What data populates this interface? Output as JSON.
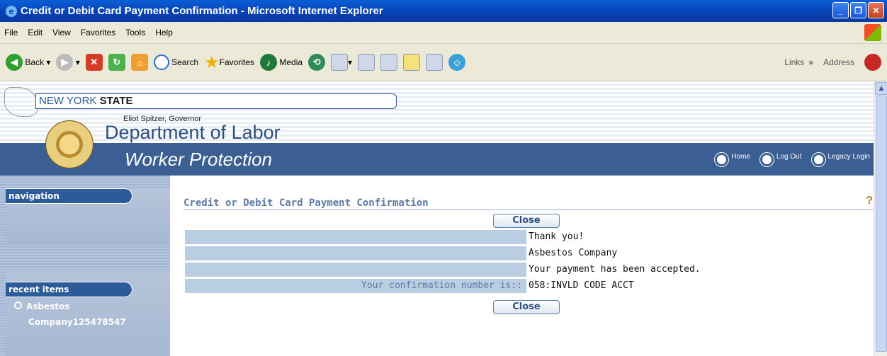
{
  "window": {
    "title": "Credit or Debit Card Payment Confirmation - Microsoft Internet Explorer"
  },
  "menu": [
    "File",
    "Edit",
    "View",
    "Favorites",
    "Tools",
    "Help"
  ],
  "toolbar": {
    "back": "Back",
    "search": "Search",
    "favorites": "Favorites",
    "media": "Media",
    "links": "Links",
    "chevron": "»",
    "address": "Address"
  },
  "header": {
    "state_plain": "NEW YORK ",
    "state_bold": "STATE",
    "governor": "Eliot Spitzer, Governor",
    "department": "Department of Labor",
    "subtitle": "Worker Protection"
  },
  "toplinks": {
    "home": "Home",
    "logout": "Log Out",
    "legacy": "Legacy Login"
  },
  "sidebar": {
    "navigation": "navigation",
    "recent_items": "recent items",
    "recent_line1": "Asbestos",
    "recent_line2": "Company125478547"
  },
  "page": {
    "title": "Credit or Debit Card Payment Confirmation",
    "help": "?",
    "close": "Close"
  },
  "rows": [
    {
      "label": "",
      "value": "Thank you!"
    },
    {
      "label": "",
      "value": "Asbestos Company"
    },
    {
      "label": "",
      "value": "Your payment has been accepted."
    },
    {
      "label": "Your confirmation number is::",
      "value": "058:INVLD CODE ACCT"
    }
  ]
}
